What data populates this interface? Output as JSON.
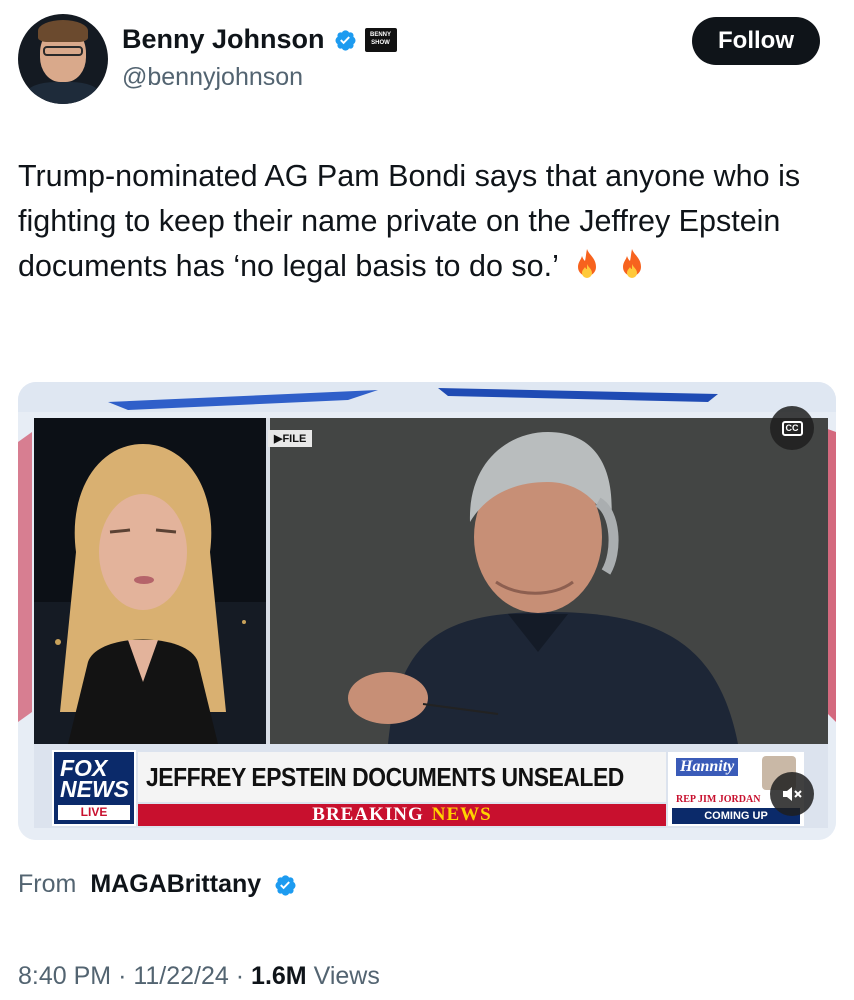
{
  "author": {
    "display_name": "Benny Johnson",
    "handle": "@bennyjohnson",
    "verified": true,
    "badge_text": "BENNY SHOW"
  },
  "follow_button": {
    "label": "Follow"
  },
  "tweet": {
    "text": "Trump-nominated AG Pam Bondi says that anyone who is fighting to keep their name private on the Jeffrey Epstein documents has ‘no legal basis to do so.’"
  },
  "media": {
    "file_tag": "▶FILE",
    "cc_label": "CC",
    "network": {
      "logo_text": "FOX NEWS",
      "live_label": "LIVE"
    },
    "headline": "JEFFREY EPSTEIN DOCUMENTS UNSEALED",
    "breaking_label_1": "BREAKING",
    "breaking_label_2": "NEWS",
    "promo": {
      "show": "Hannity",
      "guest": "REP JIM JORDAN",
      "coming_up": "COMING UP"
    }
  },
  "source": {
    "from_label": "From",
    "account": "MAGABrittany",
    "verified": true
  },
  "meta": {
    "time": "8:40 PM",
    "date": "11/22/24",
    "views_count": "1.6M",
    "views_label": "Views",
    "separator": "·"
  },
  "colors": {
    "verified_blue": "#1d9bf0",
    "text_primary": "#0f1419",
    "text_secondary": "#536471",
    "fox_red": "#c8102e",
    "fox_navy": "#0b2a6a"
  }
}
